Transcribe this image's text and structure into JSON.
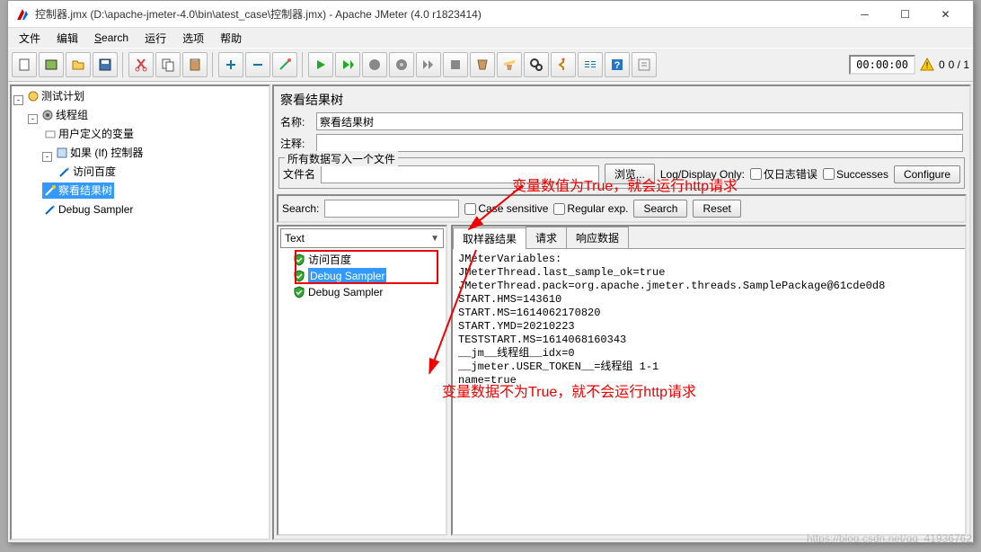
{
  "window": {
    "title": "控制器.jmx (D:\\apache-jmeter-4.0\\bin\\atest_case\\控制器.jmx) - Apache JMeter (4.0 r1823414)"
  },
  "menubar": {
    "file": "文件",
    "edit": "编辑",
    "search": "Search",
    "run": "运行",
    "options": "选项",
    "help": "帮助"
  },
  "toolbar": {
    "time": "00:00:00",
    "counts": "0 / 1",
    "zero": "0"
  },
  "tree": {
    "root": "测试计划",
    "threadgroup": "线程组",
    "uservar": "用户定义的变量",
    "ifctrl": "如果 (If) 控制器",
    "httpreq": "访问百度",
    "viewtree": "察看结果树",
    "debug": "Debug Sampler"
  },
  "panel": {
    "title": "察看结果树",
    "name_label": "名称:",
    "name_value": "察看结果树",
    "comment_label": "注释:",
    "comment_value": ""
  },
  "filegroup": {
    "legend": "所有数据写入一个文件",
    "filename_label": "文件名",
    "filename_value": "",
    "browse": "浏览...",
    "logdisplay": "Log/Display Only:",
    "errors_only": "仅日志错误",
    "successes": "Successes",
    "configure": "Configure"
  },
  "searchbar": {
    "label": "Search:",
    "value": "",
    "case": "Case sensitive",
    "regex": "Regular exp.",
    "search_btn": "Search",
    "reset_btn": "Reset"
  },
  "results": {
    "combo": "Text",
    "items": [
      "访问百度",
      "Debug Sampler",
      "Debug Sampler"
    ],
    "selected_index": 1
  },
  "tabs": {
    "sampler": "取样器结果",
    "request": "请求",
    "response": "响应数据"
  },
  "output_lines": [
    "JMeterVariables:",
    "JMeterThread.last_sample_ok=true",
    "JMeterThread.pack=org.apache.jmeter.threads.SamplePackage@61cde0d8",
    "START.HMS=143610",
    "START.MS=1614062170820",
    "START.YMD=20210223",
    "TESTSTART.MS=1614068160343",
    "__jm__线程组__idx=0",
    "__jmeter.USER_TOKEN__=线程组 1-1",
    "name=true"
  ],
  "annotations": {
    "top": "变量数值为True，就会运行http请求",
    "bottom": "变量数据不为True，就不会运行http请求"
  },
  "watermark": "https://blog.csdn.net/qq_41936762"
}
